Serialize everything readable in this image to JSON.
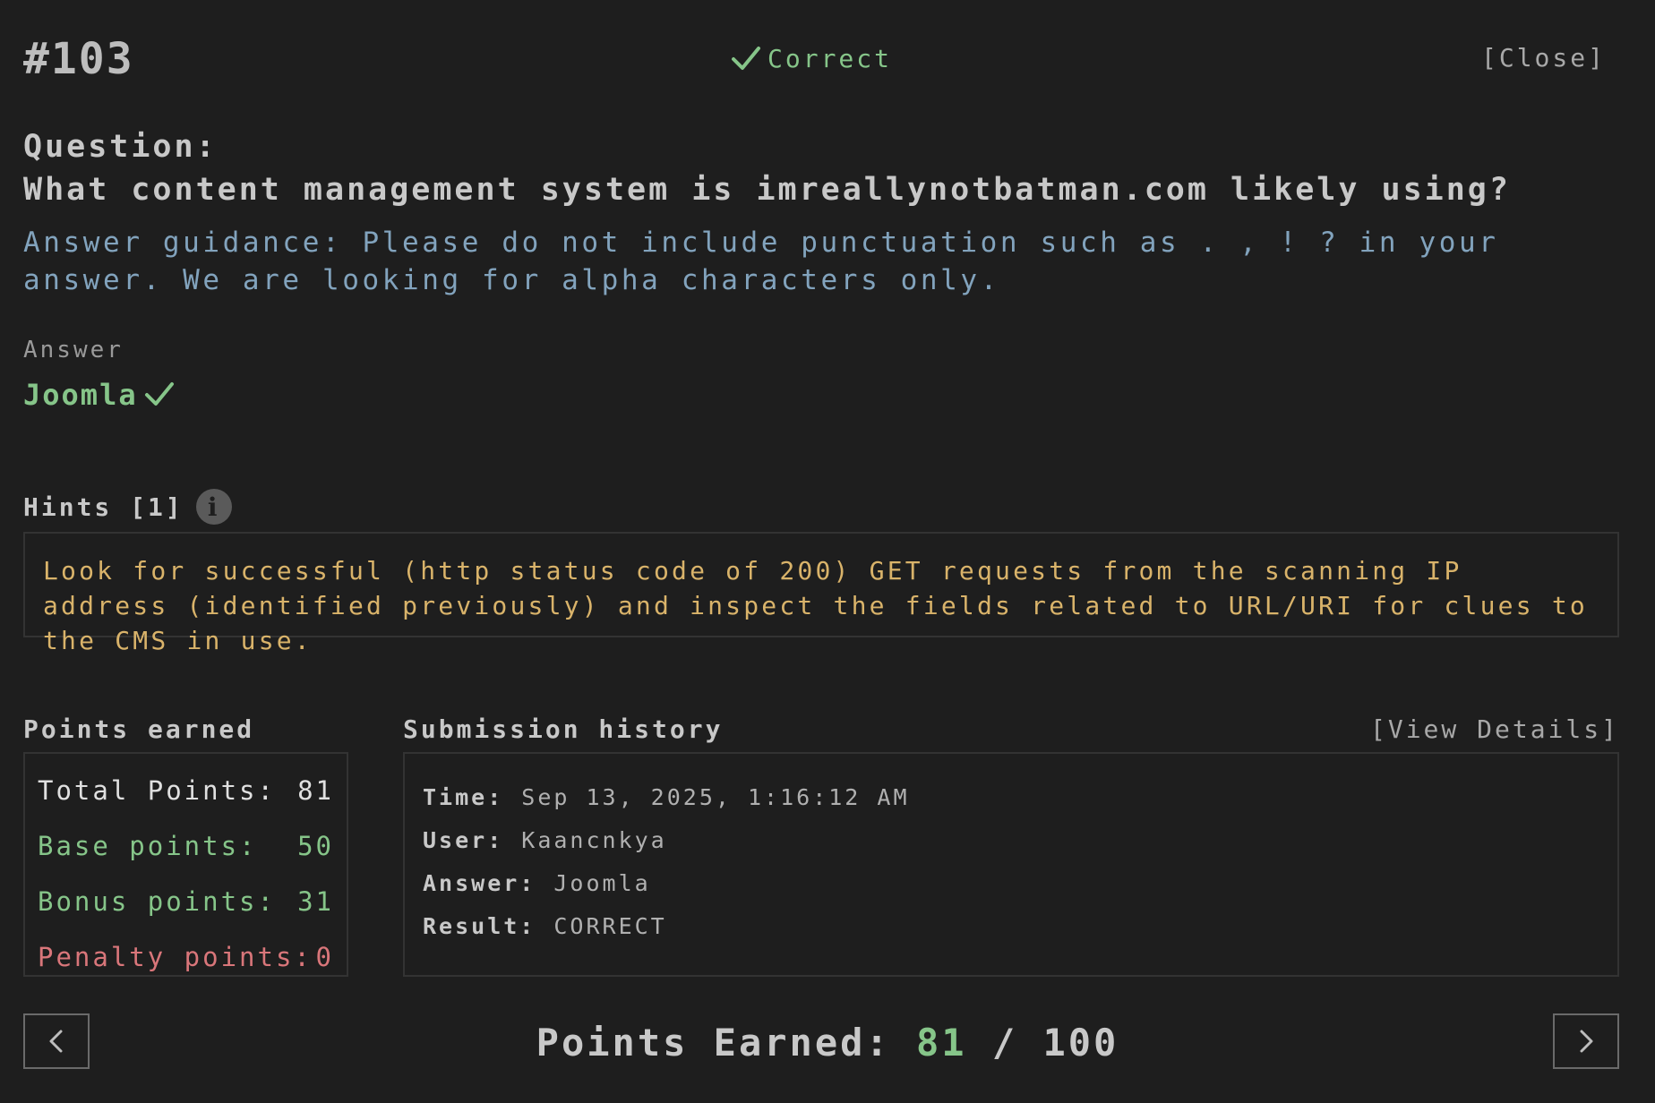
{
  "header": {
    "question_id": "#103",
    "status": "Correct",
    "close_label": "[Close]"
  },
  "question": {
    "heading": "Question:",
    "text": "What content management system is imreallynotbatman.com likely using?",
    "guidance": "Answer guidance: Please do not include punctuation such as . , ! ? in your answer. We are looking for alpha characters only."
  },
  "answer": {
    "label": "Answer",
    "value": "Joomla"
  },
  "hints": {
    "heading": "Hints [1]",
    "text": "Look for successful (http status code of 200) GET requests from the scanning IP address (identified previously) and inspect the fields related to URL/URI for clues to the CMS in use."
  },
  "points": {
    "heading": "Points earned",
    "rows": [
      {
        "label": "Total Points:",
        "value": "81"
      },
      {
        "label": "Base points:",
        "value": "50"
      },
      {
        "label": "Bonus points:",
        "value": "31"
      },
      {
        "label": "Penalty points:",
        "value": "0"
      }
    ]
  },
  "submission": {
    "heading": "Submission history",
    "view_details_label": "[View Details]",
    "rows": [
      {
        "key": "Time:",
        "value": "Sep 13, 2025, 1:16:12 AM"
      },
      {
        "key": "User:",
        "value": "Kaancnkya"
      },
      {
        "key": "Answer:",
        "value": "Joomla"
      },
      {
        "key": "Result:",
        "value": "CORRECT"
      }
    ]
  },
  "footer": {
    "label": "Points Earned:",
    "earned": "81",
    "separator": "/",
    "total": "100"
  },
  "colors": {
    "background": "#1e1e1e",
    "success": "#86c589",
    "guidance": "#82a3bd",
    "hint": "#d9b36a",
    "penalty": "#d9767a"
  },
  "icons": {
    "status": "check-icon",
    "answer": "check-icon",
    "hint_info": "info-icon",
    "prev": "chevron-left-icon",
    "next": "chevron-right-icon"
  }
}
